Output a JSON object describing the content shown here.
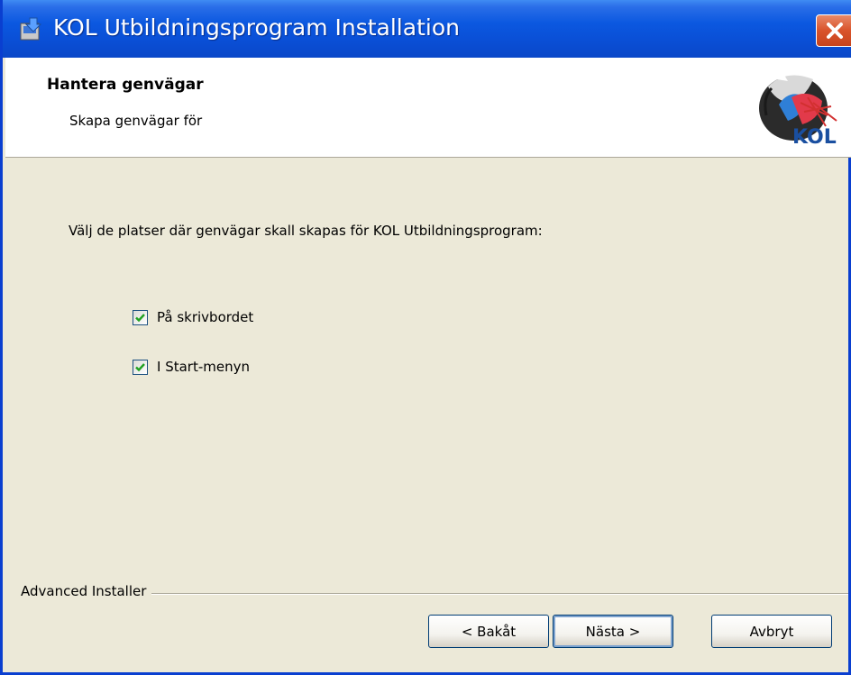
{
  "window": {
    "title": "KOL Utbildningsprogram Installation"
  },
  "header": {
    "title": "Hantera genvägar",
    "subtitle": "Skapa genvägar för",
    "logo_text": "KOL"
  },
  "main": {
    "instruction": "Välj de platser där genvägar skall skapas för KOL Utbildningsprogram:",
    "options": [
      {
        "label": "På skrivbordet",
        "checked": true
      },
      {
        "label": "I Start-menyn",
        "checked": true
      }
    ]
  },
  "footer": {
    "brand": "Advanced Installer",
    "back_label": "< Bakåt",
    "next_label": "Nästa >",
    "cancel_label": "Avbryt"
  },
  "colors": {
    "titlebar": "#0a4fd6",
    "close_button": "#d9532b",
    "dialog_background": "#ece9d8",
    "checkmark": "#21a121"
  },
  "icons": {
    "title_icon": "installer-icon",
    "close": "close-icon",
    "logo": "kol-logo",
    "check": "checkmark-icon"
  }
}
